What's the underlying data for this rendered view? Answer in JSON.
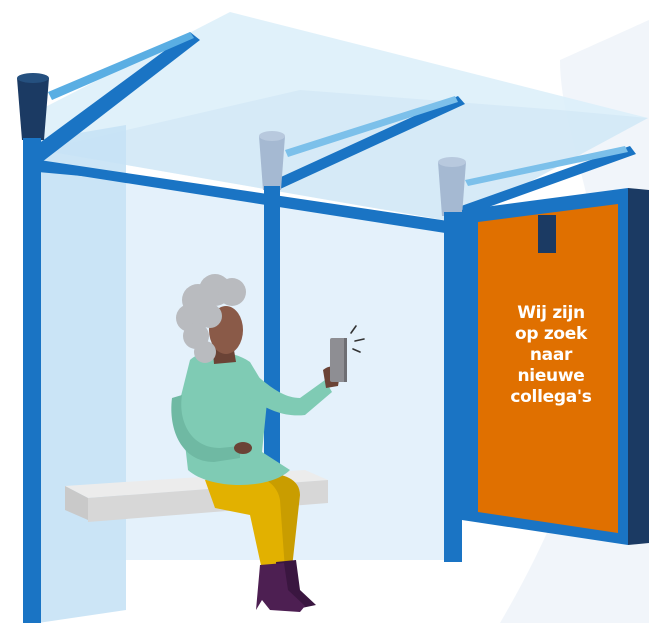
{
  "billboard": {
    "lines": [
      "Wij zijn",
      "op zoek",
      "naar",
      "nieuwe",
      "collega's"
    ]
  },
  "colors": {
    "frame_blue": "#1a74c4",
    "dark_navy": "#1b3a63",
    "glass": "#d6eaf6",
    "billboard_orange": "#e07000",
    "shirt_mint": "#7fcbb4",
    "pants_yellow": "#e2b100",
    "boots_purple": "#4d1f52",
    "hair_gray": "#b9bbbf",
    "skin": "#8a5a48",
    "phone_gray": "#8e8e93",
    "bench": "#dddddd"
  }
}
